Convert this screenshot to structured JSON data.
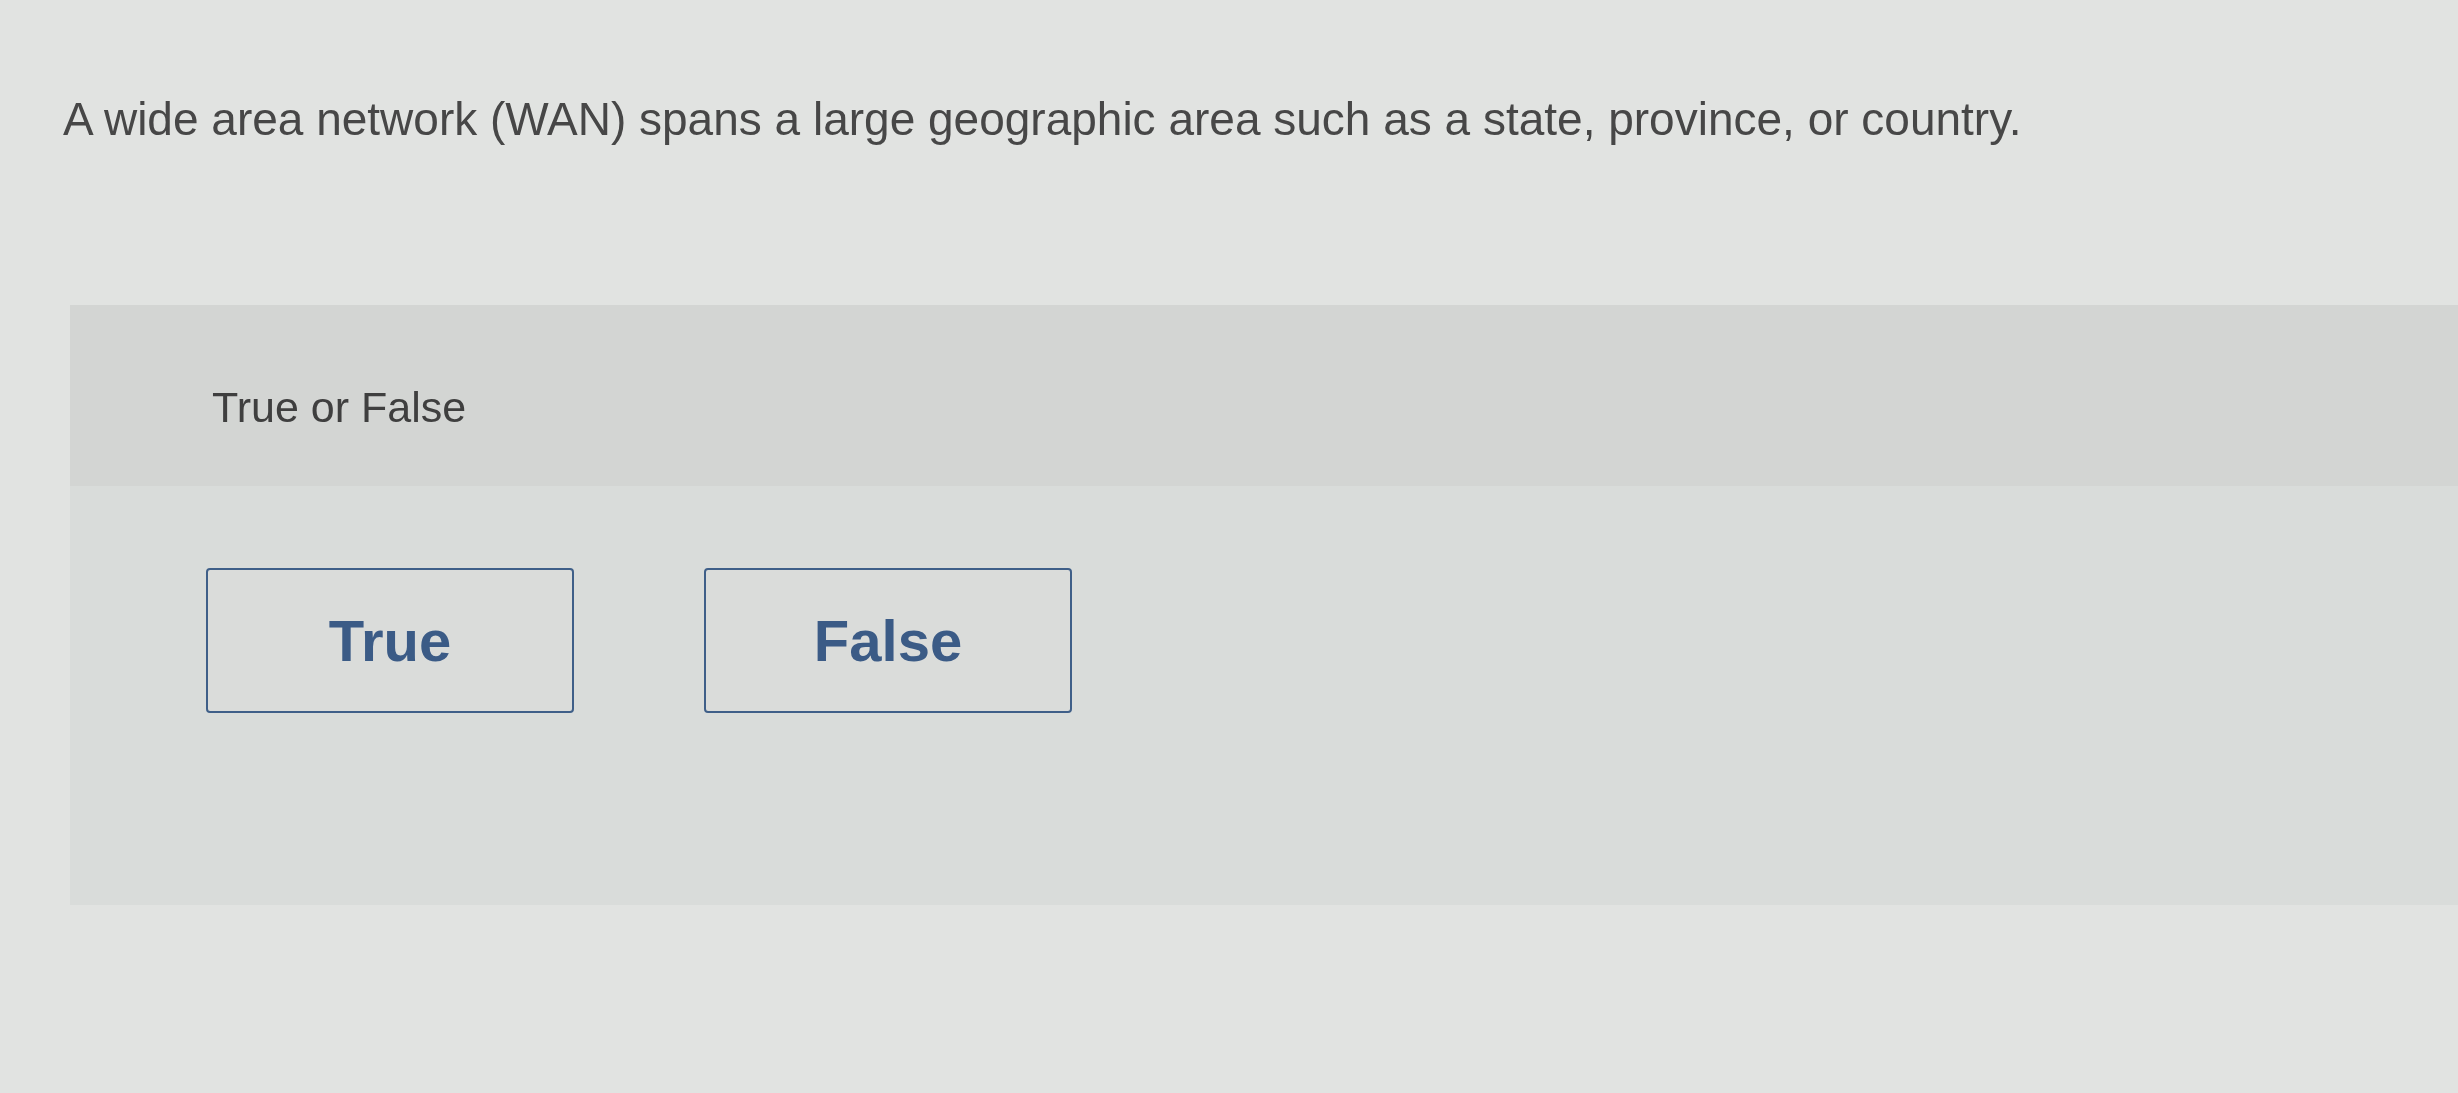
{
  "question": {
    "text": "A wide area network (WAN) spans a large geographic area such as a state, province, or country."
  },
  "answer_panel": {
    "label": "True or False",
    "options": [
      {
        "label": "True",
        "selected": false
      },
      {
        "label": "False",
        "selected": false
      }
    ]
  }
}
